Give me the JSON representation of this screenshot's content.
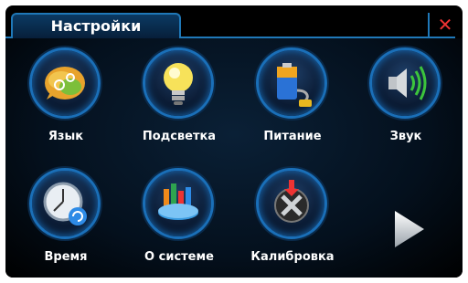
{
  "window": {
    "title": "Настройки",
    "close_icon": "close-icon"
  },
  "colors": {
    "accent": "#1f78b8",
    "close": "#e33333",
    "background": "#000000"
  },
  "menu": [
    {
      "label": "Язык",
      "icon": "language-icon"
    },
    {
      "label": "Подсветка",
      "icon": "lightbulb-icon"
    },
    {
      "label": "Питание",
      "icon": "battery-icon"
    },
    {
      "label": "Звук",
      "icon": "speaker-icon"
    },
    {
      "label": "Время",
      "icon": "clock-icon"
    },
    {
      "label": "О системе",
      "icon": "chart-icon"
    },
    {
      "label": "Калибровка",
      "icon": "calibration-icon"
    }
  ],
  "navigation": {
    "next_icon": "next-arrow-icon"
  }
}
